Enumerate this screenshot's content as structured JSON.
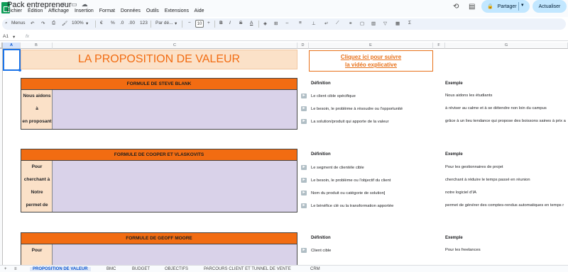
{
  "app": {
    "doc_title": "Pack entrepreneur",
    "menu": [
      "Fichier",
      "Édition",
      "Affichage",
      "Insertion",
      "Format",
      "Données",
      "Outils",
      "Extensions",
      "Aide"
    ],
    "share_label": "Partager",
    "update_label": "Actualiser"
  },
  "toolbar": {
    "menus": "Menus",
    "zoom": "100%",
    "currency": "€",
    "percent": "%",
    "dec_less": ".0",
    "dec_more": ".00",
    "format_123": "123",
    "font": "Par dé...",
    "font_size": "10",
    "bold": "B",
    "italic": "I",
    "strike": "S",
    "text_color": "A"
  },
  "formula_bar": {
    "cell_ref": "A1",
    "fx": "fx"
  },
  "columns": [
    "A",
    "B",
    "C",
    "D",
    "E",
    "F",
    "G"
  ],
  "sheet": {
    "main_title": "LA PROPOSITION DE VALEUR",
    "video_link_line1": "Cliquez ici pour suivre",
    "video_link_line2": "la vidéo explicative",
    "definition_label": "Définition",
    "example_label": "Exemple",
    "sections": [
      {
        "header": "FORMULE DE STEVE BLANK",
        "left_labels": [
          "Nous aidons",
          "à",
          "en proposant"
        ],
        "definitions": [
          "Le client cible spécifique",
          "Le besoin, le problème à résoudre ou l'opportunité",
          "La solution/produit qui apporte de la valeur"
        ],
        "examples": [
          "Nous aidons les étudiants",
          "à réviser au calme et à se détendre non loin du campus",
          "grâce à un lieu tendance qui propose des boissons saines à prix a"
        ]
      },
      {
        "header": "FORMULE DE COOPER ET VLASKOVITS",
        "left_labels": [
          "Pour",
          "cherchant à",
          "Notre",
          "permet de"
        ],
        "definitions": [
          "Le segment de clientèle cible",
          "Le besoin, le problème ou l'objectif du client",
          "Nom du produit ou catégorie de solution]",
          "Le bénéfice clé ou la transformation apportée"
        ],
        "examples": [
          "Pour les gestionnaires de projet",
          "cherchant à réduire le temps passé en réunion",
          "notre logiciel d'IA",
          "permet de générer des comptes-rendus automatiques en temps r"
        ]
      },
      {
        "header": "FORMULE DE GEOFF MOORE",
        "left_labels": [
          "Pour"
        ],
        "definitions": [
          "Client cible"
        ],
        "examples": [
          "Pour les freelances"
        ]
      }
    ]
  },
  "tabs": [
    "PROPOSITION DE VALEUR",
    "BMC",
    "BUDGET",
    "OBJECTIFS",
    "PARCOURS CLIENT ET TUNNEL DE VENTE",
    "CRM"
  ]
}
